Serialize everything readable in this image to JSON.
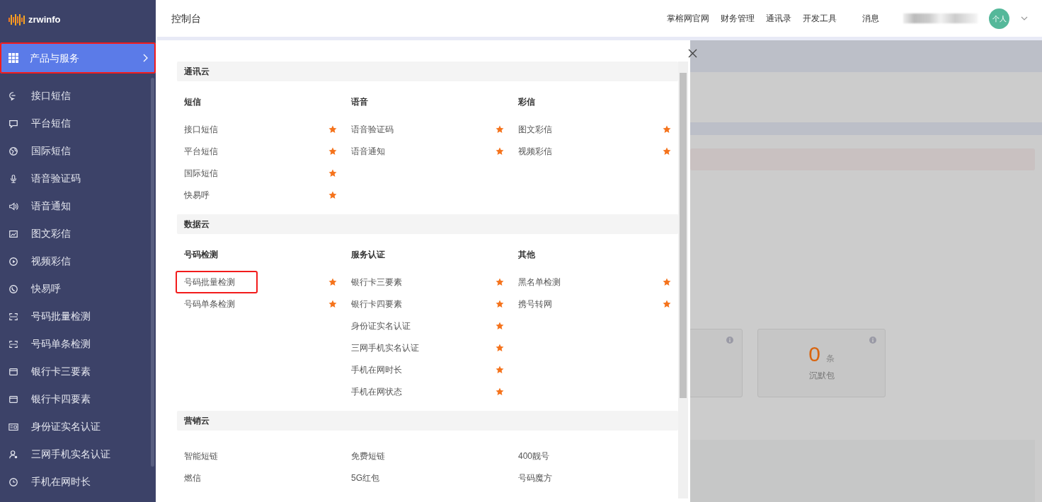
{
  "sidebar": {
    "logo": "zrwinfo",
    "products": {
      "label": "产品与服务",
      "selected": true,
      "highlighted": true
    },
    "items": [
      {
        "label": "接口短信",
        "kind": "chat"
      },
      {
        "label": "平台短信",
        "kind": "message"
      },
      {
        "label": "国际短信",
        "kind": "globe"
      },
      {
        "label": "语音验证码",
        "kind": "mic"
      },
      {
        "label": "语音通知",
        "kind": "speaker"
      },
      {
        "label": "图文彩信",
        "kind": "image"
      },
      {
        "label": "视频彩信",
        "kind": "play"
      },
      {
        "label": "快易呼",
        "kind": "phone"
      },
      {
        "label": "号码批量检测",
        "kind": "scan"
      },
      {
        "label": "号码单条检测",
        "kind": "scan"
      },
      {
        "label": "银行卡三要素",
        "kind": "card"
      },
      {
        "label": "银行卡四要素",
        "kind": "card"
      },
      {
        "label": "身份证实名认证",
        "kind": "idcard"
      },
      {
        "label": "三网手机实名认证",
        "kind": "user"
      },
      {
        "label": "手机在网时长",
        "kind": "clock"
      }
    ]
  },
  "topbar": {
    "title": "控制台",
    "links": [
      "掌榕网官网",
      "财务管理",
      "通讯录",
      "开发工具"
    ],
    "messages": "消息",
    "avatar": "个人"
  },
  "panel": {
    "sections": [
      {
        "title": "通讯云",
        "columns": [
          {
            "heading": "短信",
            "items": [
              {
                "label": "接口短信",
                "starred": true,
                "highlighted": false
              },
              {
                "label": "平台短信",
                "starred": true,
                "highlighted": false
              },
              {
                "label": "国际短信",
                "starred": true,
                "highlighted": false
              },
              {
                "label": "快易呼",
                "starred": true,
                "highlighted": false
              }
            ]
          },
          {
            "heading": "语音",
            "items": [
              {
                "label": "语音验证码",
                "starred": true,
                "highlighted": false
              },
              {
                "label": "语音通知",
                "starred": true,
                "highlighted": false
              }
            ]
          },
          {
            "heading": "彩信",
            "items": [
              {
                "label": "图文彩信",
                "starred": true,
                "highlighted": false
              },
              {
                "label": "视频彩信",
                "starred": true,
                "highlighted": false
              }
            ]
          }
        ]
      },
      {
        "title": "数据云",
        "columns": [
          {
            "heading": "号码检测",
            "items": [
              {
                "label": "号码批量检测",
                "starred": true,
                "highlighted": true
              },
              {
                "label": "号码单条检测",
                "starred": true,
                "highlighted": false
              }
            ]
          },
          {
            "heading": "服务认证",
            "items": [
              {
                "label": "银行卡三要素",
                "starred": true,
                "highlighted": false
              },
              {
                "label": "银行卡四要素",
                "starred": true,
                "highlighted": false
              },
              {
                "label": "身份证实名认证",
                "starred": true,
                "highlighted": false
              },
              {
                "label": "三网手机实名认证",
                "starred": true,
                "highlighted": false
              },
              {
                "label": "手机在网时长",
                "starred": true,
                "highlighted": false
              },
              {
                "label": "手机在网状态",
                "starred": true,
                "highlighted": false
              }
            ]
          },
          {
            "heading": "其他",
            "items": [
              {
                "label": "黑名单检测",
                "starred": true,
                "highlighted": false
              },
              {
                "label": "携号转网",
                "starred": true,
                "highlighted": false
              }
            ]
          }
        ]
      },
      {
        "title": "营销云",
        "columns": [
          {
            "items": [
              {
                "label": "智能短链",
                "starred": false,
                "highlighted": false
              },
              {
                "label": "燃信",
                "starred": false,
                "highlighted": false
              }
            ]
          },
          {
            "items": [
              {
                "label": "免费短链",
                "starred": false,
                "highlighted": false
              },
              {
                "label": "5G红包",
                "starred": false,
                "highlighted": false
              }
            ]
          },
          {
            "items": [
              {
                "label": "400靓号",
                "starred": false,
                "highlighted": false
              },
              {
                "label": "号码魔方",
                "starred": false,
                "highlighted": false
              }
            ]
          }
        ]
      }
    ]
  },
  "background": {
    "stat_card": {
      "value": "0",
      "unit": "条",
      "label": "沉默包"
    }
  }
}
